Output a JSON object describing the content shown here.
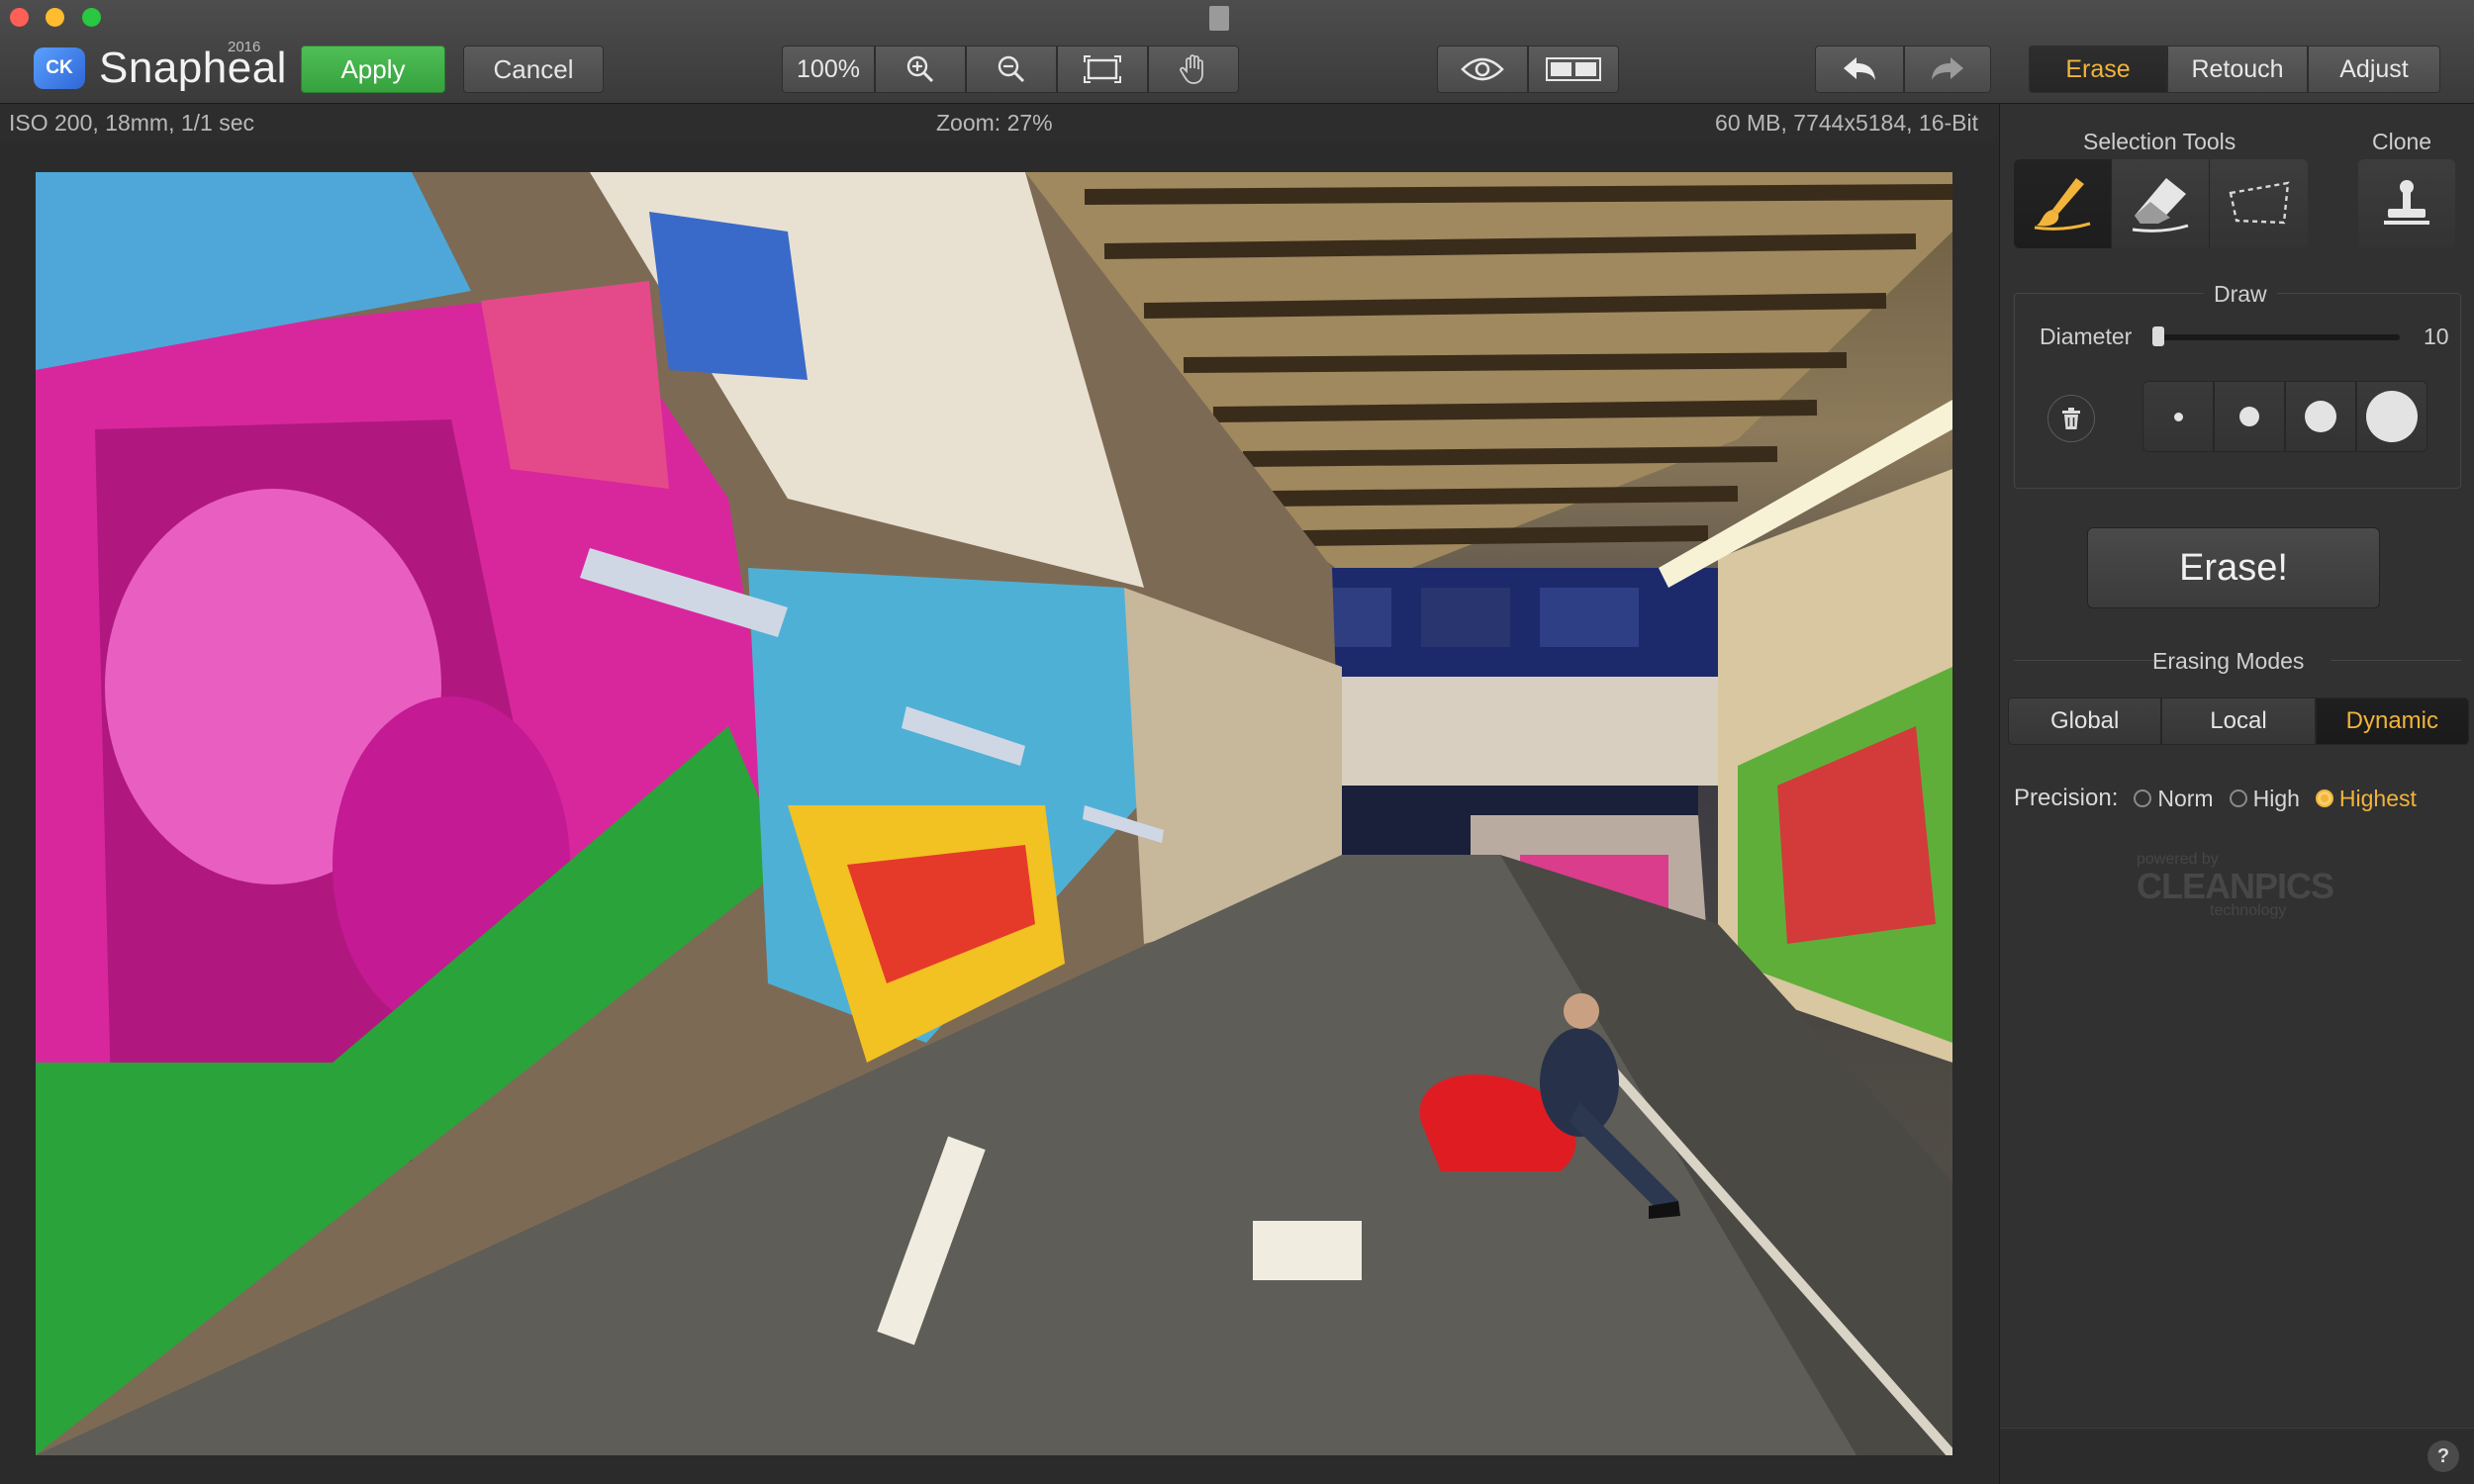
{
  "app": {
    "name": "Snapheal",
    "year": "2016",
    "badge": "CK"
  },
  "toolbar": {
    "apply_label": "Apply",
    "cancel_label": "Cancel",
    "zoom_label": "100%",
    "mode_tabs": [
      {
        "label": "Erase",
        "active": true
      },
      {
        "label": "Retouch",
        "active": false
      },
      {
        "label": "Adjust",
        "active": false
      }
    ]
  },
  "infobar": {
    "exif": "ISO 200, 18mm, 1/1 sec",
    "zoom": "Zoom: 27%",
    "file_info": "60 MB, 7744x5184, 16-Bit"
  },
  "panel": {
    "selection_tools_label": "Selection Tools",
    "clone_label": "Clone",
    "draw_label": "Draw",
    "diameter_label": "Diameter",
    "diameter_value": "10",
    "diameter_fraction": 0.0,
    "erase_button": "Erase!",
    "erasing_modes_label": "Erasing Modes",
    "modes": [
      {
        "label": "Global",
        "active": false
      },
      {
        "label": "Local",
        "active": false
      },
      {
        "label": "Dynamic",
        "active": true
      }
    ],
    "precision_label": "Precision:",
    "precision_options": [
      {
        "label": "Norm",
        "selected": false
      },
      {
        "label": "High",
        "selected": false
      },
      {
        "label": "Highest",
        "selected": true
      }
    ],
    "powered_by": "powered by",
    "powered_brand": "CLEANPICS",
    "powered_tech": "technology",
    "help": "?"
  },
  "colors": {
    "accent": "#f2b43a",
    "apply_green": "#3fb147",
    "panel_bg": "#313131"
  }
}
